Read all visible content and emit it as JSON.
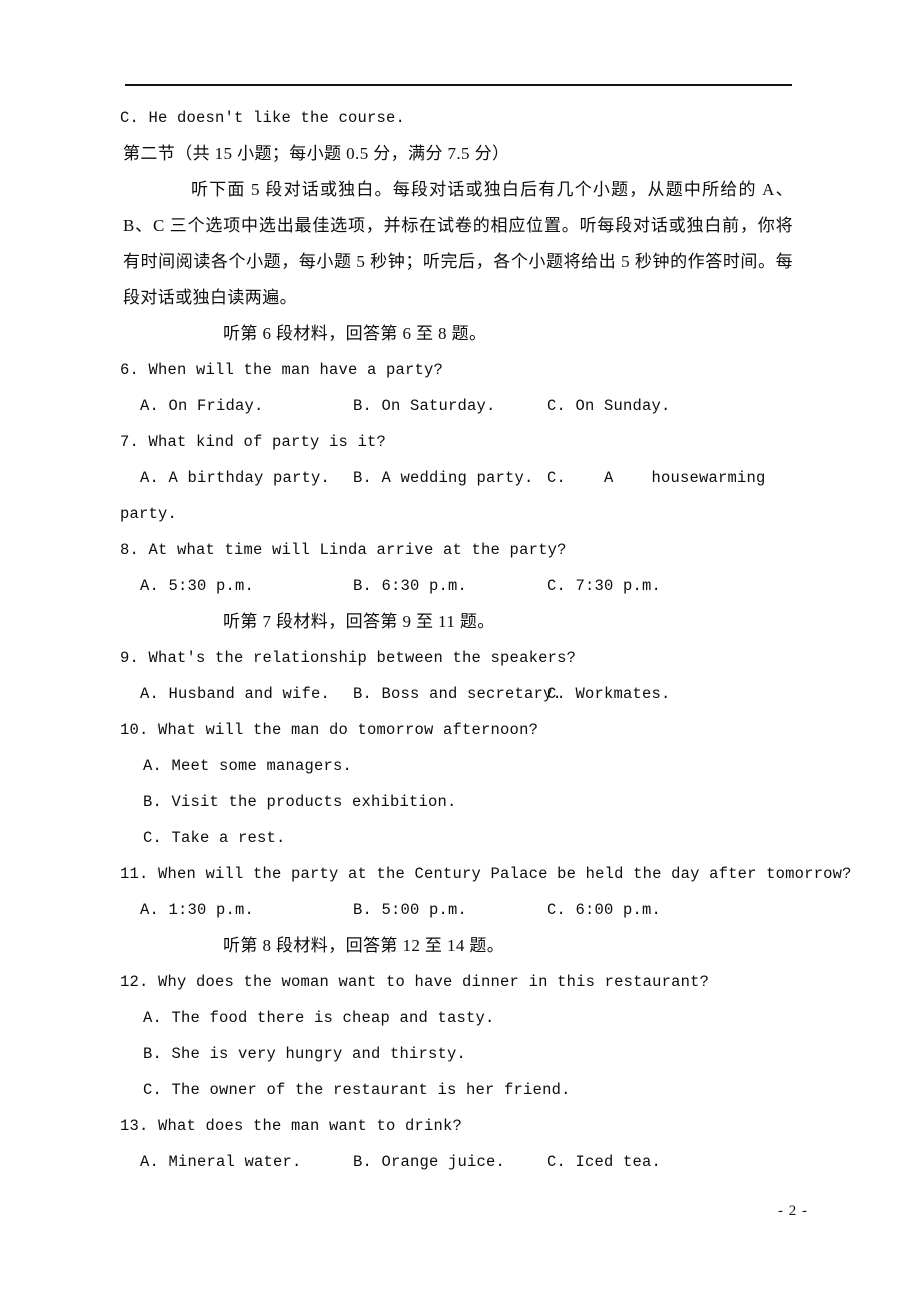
{
  "document": {
    "page_number": "- 2 -",
    "header_rule": true
  },
  "content": {
    "carryover_option": "C. He doesn't like the course.",
    "section_heading": "第二节（共 15 小题；每小题 0.5 分，满分 7.5 分）",
    "instructions": "听下面 5 段对话或独白。每段对话或独白后有几个小题，从题中所给的 A、B、C 三个选项中选出最佳选项，并标在试卷的相应位置。听每段对话或独白前，你将有时间阅读各个小题，每小题 5 秒钟；听完后，各个小题将给出 5 秒钟的作答时间。每段对话或独白读两遍。",
    "direction_6_8": "听第 6 段材料，回答第 6 至 8 题。",
    "direction_9_11": "听第 7 段材料，回答第 9 至 11 题。",
    "direction_12_14": "听第 8 段材料，回答第 12 至 14 题。",
    "questions": [
      {
        "number": "6.",
        "stem": "6. When will the man have a party?",
        "layout": "row",
        "options": [
          "A. On Friday.",
          "B. On Saturday.",
          "C. On Sunday."
        ]
      },
      {
        "number": "7.",
        "stem": "7. What kind of party is it?",
        "layout": "row-wrap",
        "options": [
          "A. A birthday party.",
          "B. A wedding party.",
          "C.    A    housewarming",
          "party."
        ]
      },
      {
        "number": "8.",
        "stem": "8. At what time will Linda arrive at the party?",
        "layout": "row",
        "options": [
          "A. 5:30 p.m.",
          "B. 6:30 p.m.",
          "C. 7:30 p.m."
        ]
      },
      {
        "number": "9.",
        "stem": "9. What's the relationship between the speakers?",
        "layout": "row",
        "options": [
          "A. Husband and wife.",
          "B. Boss and secretary.",
          "C. Workmates."
        ]
      },
      {
        "number": "10.",
        "stem": "10. What will the man do tomorrow afternoon?",
        "layout": "stack",
        "options": [
          "A. Meet some managers.",
          "B. Visit the products exhibition.",
          "C. Take a rest."
        ]
      },
      {
        "number": "11.",
        "stem": "11. When will the party at the Century Palace be held the day after tomorrow?",
        "layout": "row",
        "options": [
          "A. 1:30 p.m.",
          "B. 5:00 p.m.",
          "C. 6:00 p.m."
        ]
      },
      {
        "number": "12.",
        "stem": "12. Why does the woman want to have dinner in this restaurant?",
        "layout": "stack",
        "options": [
          "A. The food there is cheap and tasty.",
          "B. She is very hungry and thirsty.",
          "C. The owner of the restaurant is her friend."
        ]
      },
      {
        "number": "13.",
        "stem": "13. What does the man want to drink?",
        "layout": "row",
        "options": [
          "A. Mineral water.",
          "B. Orange juice.",
          "C. Iced tea."
        ]
      }
    ]
  }
}
